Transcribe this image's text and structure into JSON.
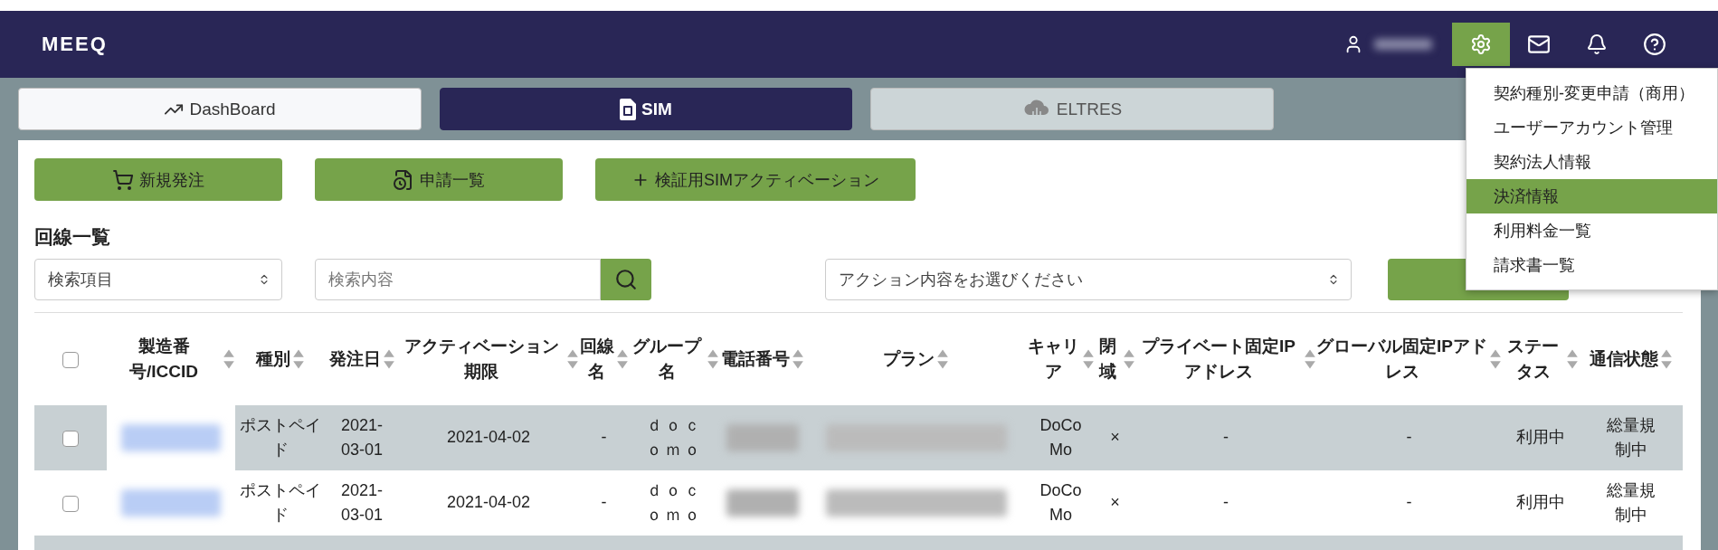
{
  "header": {
    "logo": "MEEQ",
    "icons": [
      {
        "kind": "user",
        "selected": false
      },
      {
        "kind": "settings",
        "selected": true
      },
      {
        "kind": "mail",
        "selected": false
      },
      {
        "kind": "bell",
        "selected": false
      },
      {
        "kind": "help",
        "selected": false
      }
    ]
  },
  "nav_tabs": [
    {
      "label": "DashBoard",
      "kind": "chart",
      "selected": false,
      "disabled": false
    },
    {
      "label": "SIM",
      "kind": "sim",
      "selected": true,
      "disabled": false
    },
    {
      "label": "ELTRES",
      "kind": "cloud",
      "selected": false,
      "disabled": true
    }
  ],
  "actions": [
    {
      "label": "新規発注",
      "kind": "cart"
    },
    {
      "label": "申請一覧",
      "kind": "clock"
    },
    {
      "label": "検証用SIMアクティベーション",
      "kind": "plus"
    }
  ],
  "section_title": "回線一覧",
  "filters": {
    "search_item": {
      "value": "検索項目"
    },
    "search": {
      "placeholder": "検索内容"
    },
    "action": {
      "placeholder": "アクション内容をお選びください"
    }
  },
  "settings_menu": {
    "items": [
      {
        "label": "契約種別-変更申請（商用）",
        "selected": false
      },
      {
        "label": "ユーザーアカウント管理",
        "selected": false
      },
      {
        "label": "契約法人情報",
        "selected": false
      },
      {
        "label": "決済情報",
        "selected": true
      },
      {
        "label": "利用料金一覧",
        "selected": false
      },
      {
        "label": "請求書一覧",
        "selected": false
      }
    ]
  },
  "table": {
    "header_checked": false,
    "columns": [
      "製造番号/ICCID",
      "種別",
      "発注日",
      "アクティベーション期限",
      "回線名",
      "グループ名",
      "電話番号",
      "プラン",
      "キャリア",
      "閉域",
      "プライベート固定IPアドレス",
      "グローバル固定IPアドレス",
      "ステータス",
      "通信状態"
    ],
    "rows": [
      {
        "checked": false,
        "type": "ポストペイド",
        "order_date": "2021-03-01",
        "activation_deadline": "2021-04-02",
        "line_name": "-",
        "group": "ｄｏｃｏｍｏ",
        "carrier": "DoCoMo",
        "closed_network": "×",
        "private_ip": "-",
        "global_ip": "-",
        "status": "利用中",
        "connection": "総量規制中"
      },
      {
        "checked": false,
        "type": "ポストペイド",
        "order_date": "2021-03-01",
        "activation_deadline": "2021-04-02",
        "line_name": "-",
        "group": "ｄｏｃｏｍｏ",
        "carrier": "DoCoMo",
        "closed_network": "×",
        "private_ip": "-",
        "global_ip": "-",
        "status": "利用中",
        "connection": "総量規制中"
      }
    ]
  }
}
